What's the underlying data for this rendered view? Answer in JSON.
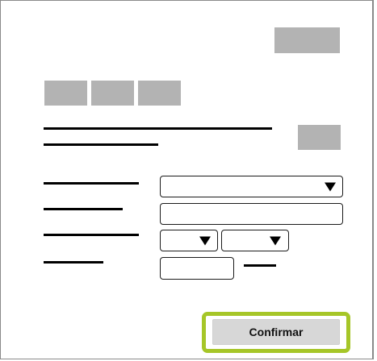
{
  "form": {
    "confirm_button_label": "Confirmar",
    "colors": {
      "placeholder_block": "#b3b3b3",
      "highlight_border": "#a6c628",
      "button_bg": "#d7d7d7",
      "frame_border": "#8a8a8a"
    }
  }
}
